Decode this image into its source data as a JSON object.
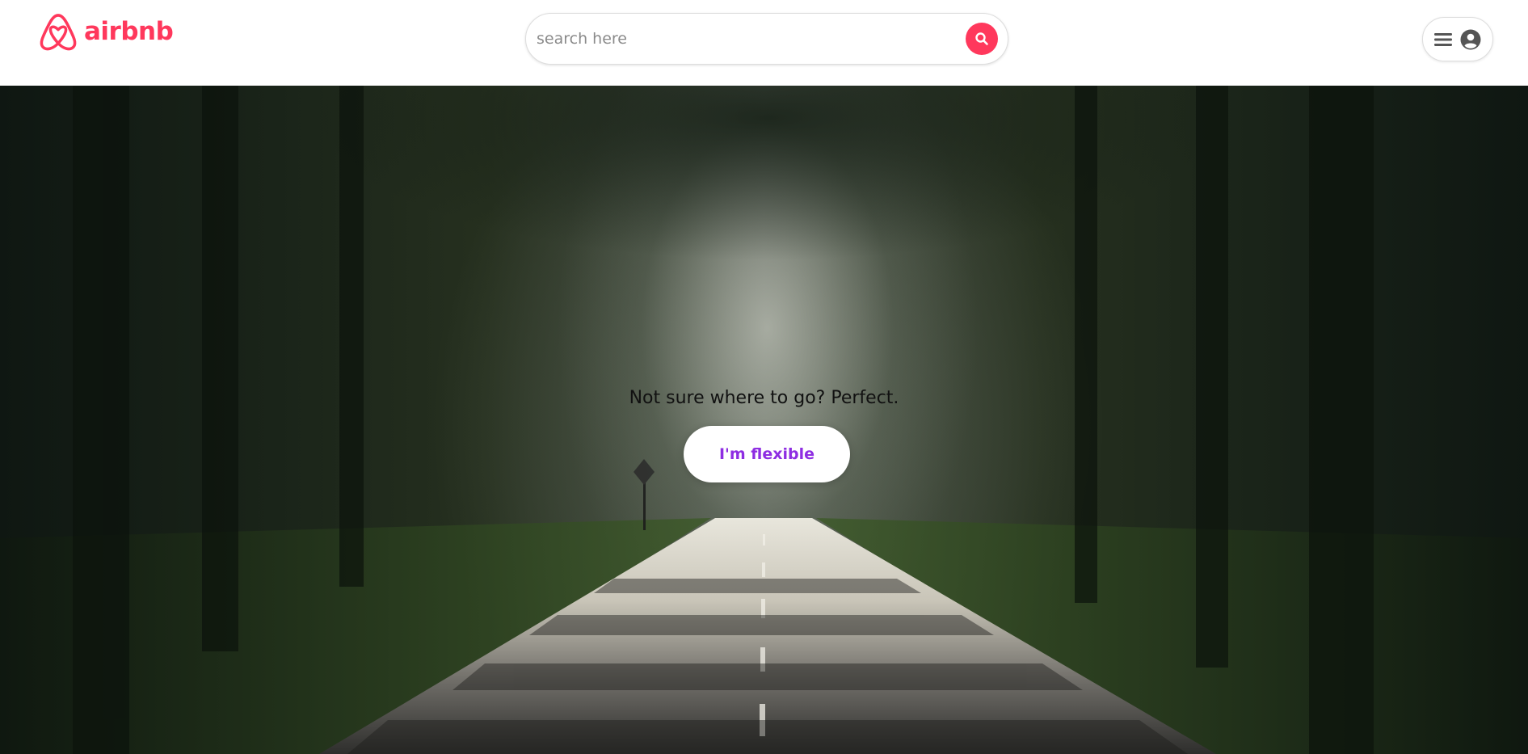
{
  "header": {
    "logo_text": "airbnb",
    "search": {
      "placeholder": "search here",
      "value": ""
    }
  },
  "hero": {
    "tagline": "Not sure where to go? Perfect.",
    "cta_label": "I'm flexible"
  },
  "colors": {
    "brand": "#ff385c",
    "cta_text": "#8e2de2",
    "icon_gray": "#555555"
  },
  "icons": {
    "logo": "airbnb-logo-icon",
    "search": "search-icon",
    "menu": "hamburger-menu-icon",
    "user": "user-avatar-icon"
  }
}
